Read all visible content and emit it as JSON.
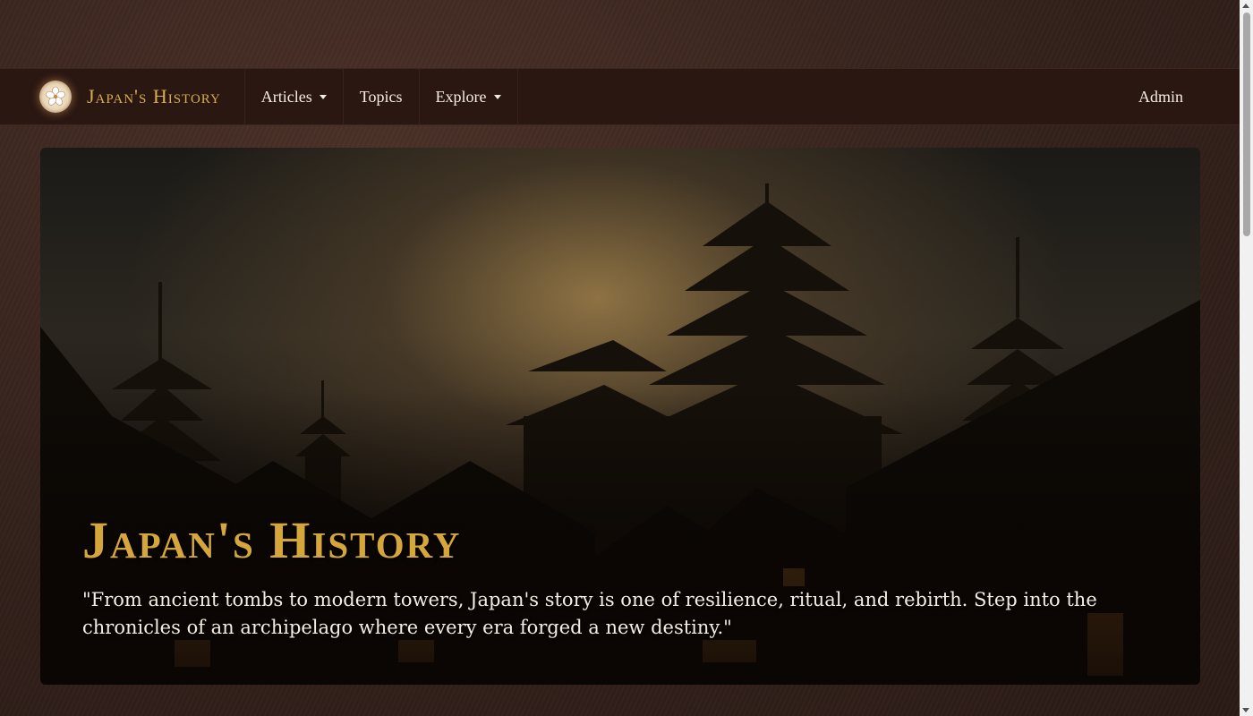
{
  "nav": {
    "brand": "Japan's History",
    "items": [
      {
        "label": "Articles",
        "dropdown": true
      },
      {
        "label": "Topics",
        "dropdown": false
      },
      {
        "label": "Explore",
        "dropdown": true
      }
    ],
    "admin": "Admin"
  },
  "hero": {
    "title": "Japan's History",
    "quote": "\"From ancient tombs to modern towers, Japan's story is one of resilience, ritual, and rebirth. Step into the chronicles of an archipelago where every era forged a new destiny.\""
  },
  "colors": {
    "brand_gold": "#d7ad4c",
    "nav_bg": "#2a1712",
    "page_bg": "#33211b"
  }
}
